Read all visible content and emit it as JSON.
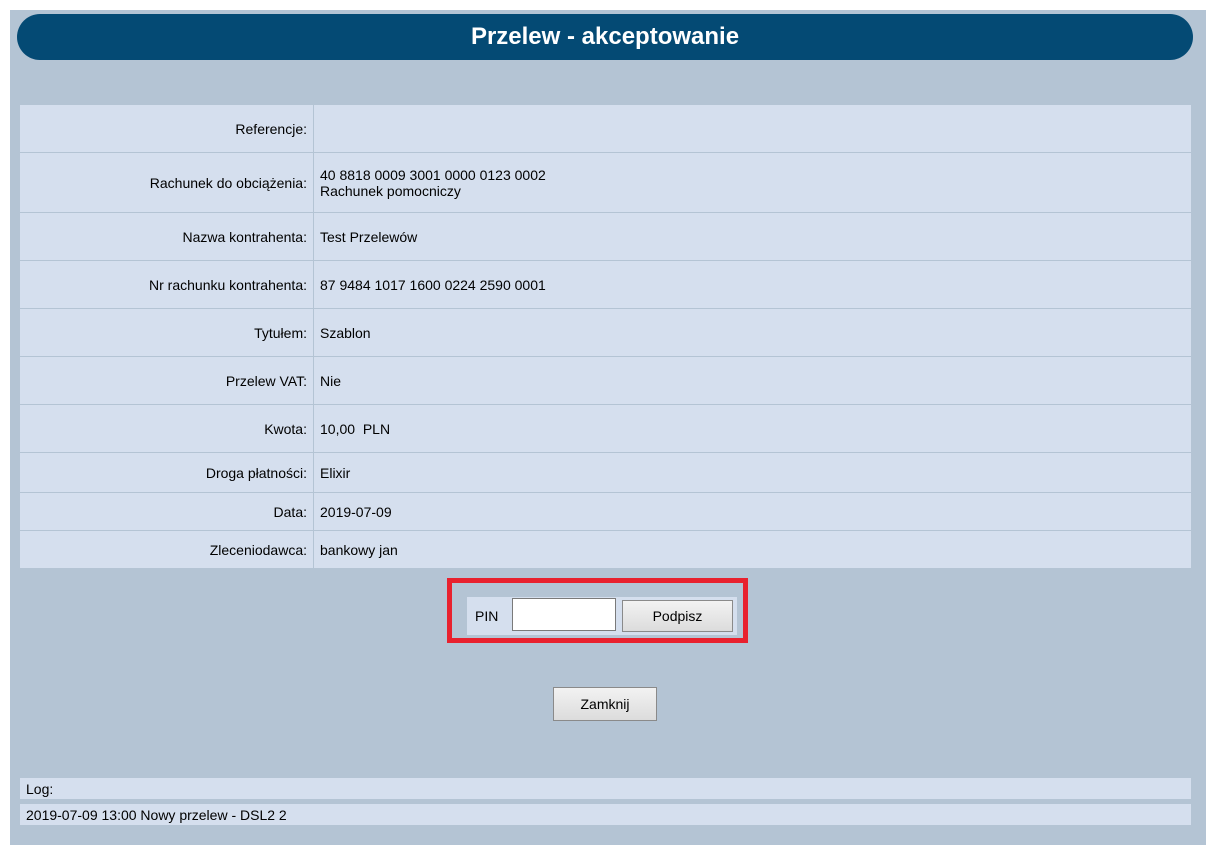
{
  "page": {
    "title": "Przelew - akceptowanie"
  },
  "details": [
    {
      "label": "Referencje:",
      "value": ""
    },
    {
      "label": "Rachunek do obciążenia:",
      "value": "40 8818 0009 3001 0000 0123 0002",
      "value2": "Rachunek pomocniczy"
    },
    {
      "label": "Nazwa kontrahenta:",
      "value": "Test Przelewów"
    },
    {
      "label": "Nr rachunku kontrahenta:",
      "value": "87 9484 1017 1600 0224 2590 0001"
    },
    {
      "label": "Tytułem:",
      "value": "Szablon"
    },
    {
      "label": "Przelew VAT:",
      "value": "Nie"
    },
    {
      "label": "Kwota:",
      "value": "10,00  PLN"
    },
    {
      "label": "Droga płatności:",
      "value": "Elixir"
    },
    {
      "label": "Data:",
      "value": "2019-07-09"
    },
    {
      "label": "Zleceniodawca:",
      "value": "bankowy jan"
    }
  ],
  "sign": {
    "pin_label": "PIN",
    "pin_value": "",
    "sign_button": "Podpisz",
    "highlight_color": "#e8212e"
  },
  "close_button": "Zamknij",
  "log": {
    "label": "Log:",
    "entries": [
      "2019-07-09 13:00 Nowy przelew - DSL2 2"
    ]
  },
  "colors": {
    "title_bar": "#044a74",
    "panel": "#b4c4d4",
    "row_bg": "#d5dfee"
  }
}
